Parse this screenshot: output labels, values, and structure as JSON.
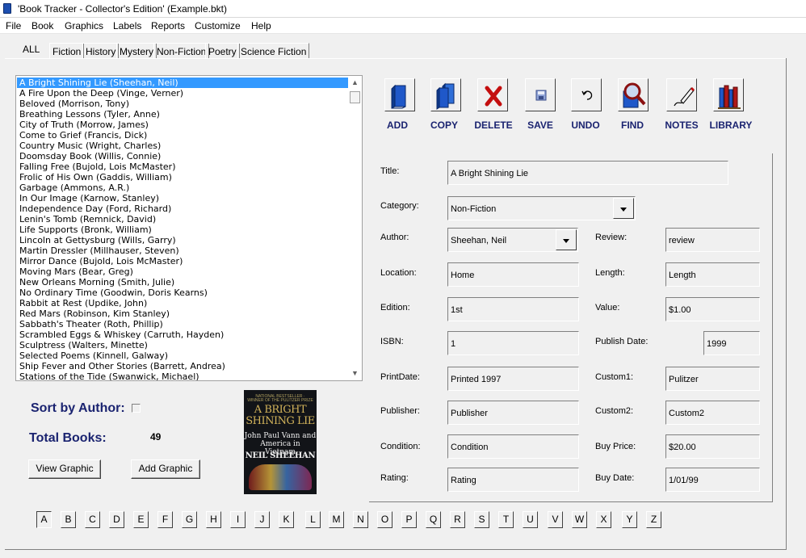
{
  "window": {
    "title": "'Book Tracker - Collector's Edition'     (Example.bkt)"
  },
  "menu": [
    "File",
    "Book",
    "Graphics",
    "Labels",
    "Reports",
    "Customize",
    "Help"
  ],
  "tabs": [
    "ALL",
    "Fiction",
    "History",
    "Mystery",
    "Non-Fiction",
    "Poetry",
    "Science Fiction"
  ],
  "books": [
    "A Bright Shining Lie (Sheehan, Neil)",
    "A Fire Upon the Deep (Vinge, Verner)",
    "Beloved (Morrison, Tony)",
    "Breathing Lessons (Tyler, Anne)",
    "City of Truth (Morrow, James)",
    "Come to Grief (Francis, Dick)",
    "Country Music (Wright, Charles)",
    "Doomsday Book (Willis, Connie)",
    "Falling Free (Bujold, Lois McMaster)",
    "Frolic of His Own (Gaddis, William)",
    "Garbage (Ammons, A.R.)",
    "In Our Image (Karnow, Stanley)",
    "Independence Day (Ford, Richard)",
    "Lenin's Tomb (Remnick, David)",
    "Life Supports (Bronk, William)",
    "Lincoln at Gettysburg (Wills, Garry)",
    "Martin Dressler (Millhauser, Steven)",
    "Mirror Dance (Bujold, Lois McMaster)",
    "Moving Mars (Bear, Greg)",
    "New Orleans Morning (Smith, Julie)",
    "No Ordinary Time (Goodwin, Doris Kearns)",
    "Rabbit at Rest (Updike, John)",
    "Red Mars (Robinson, Kim Stanley)",
    "Sabbath's Theater (Roth, Phillip)",
    "Scrambled Eggs & Whiskey (Carruth, Hayden)",
    "Sculptress (Walters, Minette)",
    "Selected Poems (Kinnell, Galway)",
    "Ship Fever and Other Stories (Barrett, Andrea)",
    "Stations of the Tide (Swanwick, Michael)"
  ],
  "left": {
    "sort_label": "Sort by Author:",
    "total_label": "Total Books:",
    "total_value": "49",
    "view_graphic": "View Graphic",
    "add_graphic": "Add Graphic"
  },
  "cover": {
    "top_text": "NATIONAL BESTSELLER · WINNER OF THE PULITZER PRIZE",
    "title": "A BRIGHT SHINING LIE",
    "subtitle": "John Paul Vann and America in Vietnam",
    "author": "NEIL SHEEHAN"
  },
  "toolbar": [
    {
      "label": "ADD",
      "icon": "blue-book-icon"
    },
    {
      "label": "COPY",
      "icon": "two-books-icon"
    },
    {
      "label": "DELETE",
      "icon": "red-x-icon"
    },
    {
      "label": "SAVE",
      "icon": "floppy-disk-icon"
    },
    {
      "label": "UNDO",
      "icon": "undo-arrow-icon"
    },
    {
      "label": "FIND",
      "icon": "magnifier-book-icon"
    },
    {
      "label": "NOTES",
      "icon": "pen-notes-icon"
    },
    {
      "label": "LIBRARY",
      "icon": "bookshelf-icon"
    }
  ],
  "form": {
    "title": {
      "label": "Title:",
      "value": "A Bright Shining Lie"
    },
    "category": {
      "label": "Category:",
      "value": "Non-Fiction"
    },
    "author": {
      "label": "Author:",
      "value": "Sheehan, Neil"
    },
    "review": {
      "label": "Review:",
      "value": "review"
    },
    "location": {
      "label": "Location:",
      "value": "Home"
    },
    "length": {
      "label": "Length:",
      "value": "Length"
    },
    "edition": {
      "label": "Edition:",
      "value": "1st"
    },
    "value": {
      "label": "Value:",
      "value": "$1.00"
    },
    "isbn": {
      "label": "ISBN:",
      "value": "1"
    },
    "publish_date": {
      "label": "Publish Date:",
      "value": "1999"
    },
    "print_date": {
      "label": "PrintDate:",
      "value": "Printed 1997"
    },
    "custom1": {
      "label": "Custom1:",
      "value": "Pulitzer"
    },
    "publisher": {
      "label": "Publisher:",
      "value": "Publisher"
    },
    "custom2": {
      "label": "Custom2:",
      "value": "Custom2"
    },
    "condition": {
      "label": "Condition:",
      "value": "Condition"
    },
    "buy_price": {
      "label": "Buy Price:",
      "value": "$20.00"
    },
    "rating": {
      "label": "Rating:",
      "value": "Rating"
    },
    "buy_date": {
      "label": "Buy Date:",
      "value": "1/01/99"
    }
  },
  "letters": [
    "A",
    "B",
    "C",
    "D",
    "E",
    "F",
    "G",
    "H",
    "I",
    "J",
    "K",
    "L",
    "M",
    "N",
    "O",
    "P",
    "Q",
    "R",
    "S",
    "T",
    "U",
    "V",
    "W",
    "X",
    "Y",
    "Z"
  ],
  "colors": {
    "accent": "#1a2370",
    "selection": "#3399ff",
    "background": "#f0f0f0"
  }
}
